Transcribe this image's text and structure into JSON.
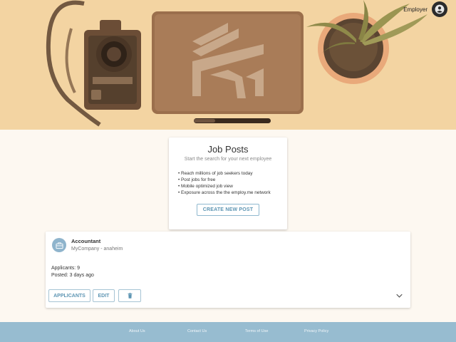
{
  "header": {
    "account_label": "Employer",
    "account_icon": "account-circle-icon"
  },
  "posts_card": {
    "title": "Job Posts",
    "subtitle": "Start the search for your next employee",
    "bullets": [
      "• Reach millions of job seekers today",
      "• Post jobs for free",
      "• Mobile optimized job view",
      "• Exposure across the the employ.me network"
    ],
    "create_button": "CREATE NEW POST"
  },
  "job": {
    "icon": "briefcase-icon",
    "title": "Accountant",
    "company": "MyCompany - anaheim",
    "applicants": "Applicants: 9",
    "posted": "Posted: 3 days ago",
    "applicants_button": "APPLICANTS",
    "edit_button": "EDIT",
    "delete_icon": "trash-icon",
    "expand_icon": "chevron-down-icon"
  },
  "footer": {
    "links": [
      "About Us",
      "Contact Us",
      "Terms of Use",
      "Privacy Policy"
    ]
  },
  "colors": {
    "hero_tint": "#f3d4a2",
    "accent": "#5d95b3",
    "footer_bg": "#97bcd0",
    "page_bg": "#fdf8f1"
  }
}
